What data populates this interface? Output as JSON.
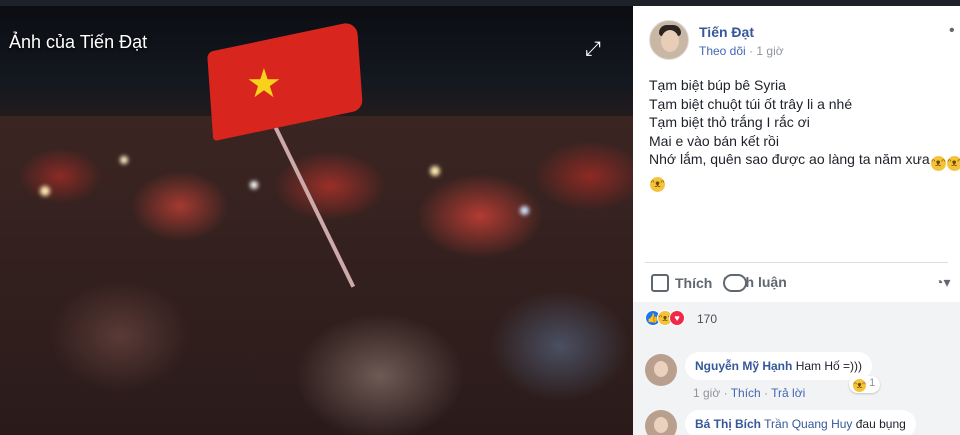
{
  "photo": {
    "title": "Ảnh của Tiến Đạt",
    "expand_icon": "expand-icon"
  },
  "post": {
    "author": "Tiến Đạt",
    "follow": "Theo dõi",
    "time": "1 giờ",
    "more_icon": "more-icon",
    "lines": [
      "Tạm biệt búp bê Syria",
      "Tạm biệt chuột túi ốt trây li a nhé",
      "Tạm biệt thỏ trắng I rắc ơi",
      "Mai e vào bán kết rồi",
      "Nhớ lắm, quên sao được ao làng ta năm xưa"
    ],
    "emoji": "haha-emoji"
  },
  "actions": {
    "like_label": "Thích",
    "comment_label": "Bình luận"
  },
  "reactions": {
    "count": "170",
    "colors": {
      "like": "#1877f2",
      "haha": "#f5c33b",
      "love": "#f0284a"
    }
  },
  "comments": [
    {
      "name": "Nguyễn Mỹ Hạnh",
      "text": "Ham Hố =)))",
      "time": "1 giờ",
      "like_label": "Thích",
      "reply_label": "Trả lời",
      "reaction_count": "1"
    },
    {
      "name": "Bá Thị Bích",
      "tag": "Trần Quang Huy",
      "text": "đau bụng"
    }
  ],
  "theme": {
    "link": "#365899",
    "panel_bg": "#ffffff",
    "meta": "#90949c"
  }
}
